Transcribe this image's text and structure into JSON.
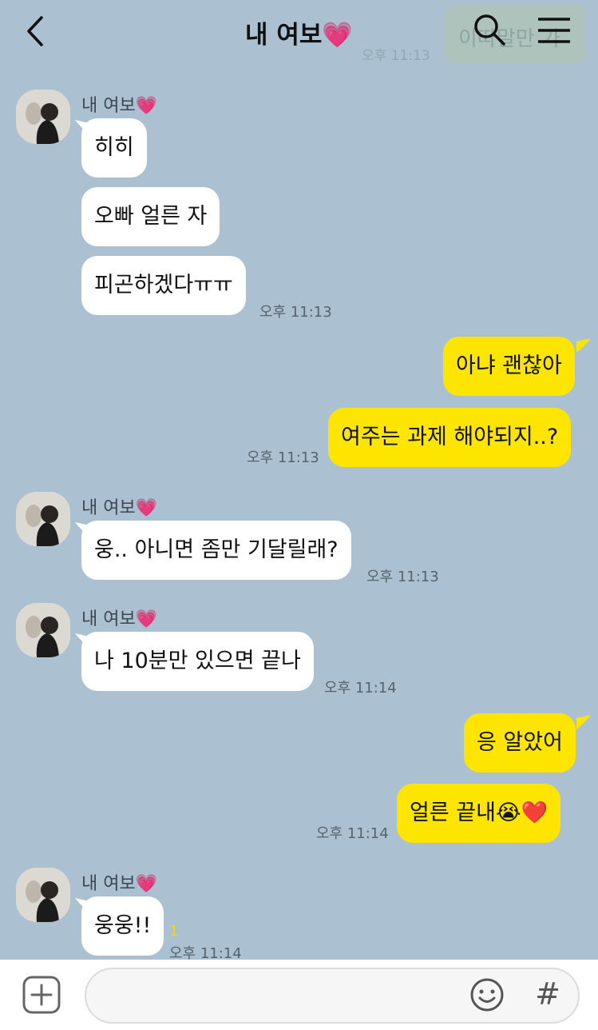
{
  "header": {
    "title": "내 여보💗",
    "ghost_preview": "이따말만 가",
    "ghost_time": "오후 11:13"
  },
  "messages": [
    {
      "sender": "내 여보💗",
      "text": "히히",
      "time": ""
    },
    {
      "text": "오빠 얼른 자",
      "time": ""
    },
    {
      "text": "피곤하겠다ㅠㅠ",
      "time": "오후 11:13"
    },
    {
      "text": "아냐 괜찮아",
      "time": ""
    },
    {
      "text": "여주는 과제 해야되지..?",
      "time": "오후 11:13"
    },
    {
      "sender": "내 여보💗",
      "text": "웅.. 아니면 좀만 기달릴래?",
      "time": "오후 11:13"
    },
    {
      "sender": "내 여보💗",
      "text": "나 10분만 있으면 끝나",
      "time": "오후 11:14"
    },
    {
      "text": "응 알았어",
      "time": ""
    },
    {
      "text": "얼른 끝내😭❤️",
      "time": "오후 11:14"
    },
    {
      "sender": "내 여보💗",
      "text": "웅웅!!",
      "time": "오후 11:14",
      "unread": "1"
    }
  ],
  "composer": {
    "placeholder": ""
  },
  "colors": {
    "background": "#abc1d1",
    "incoming_bubble": "#ffffff",
    "outgoing_bubble": "#fee500"
  }
}
